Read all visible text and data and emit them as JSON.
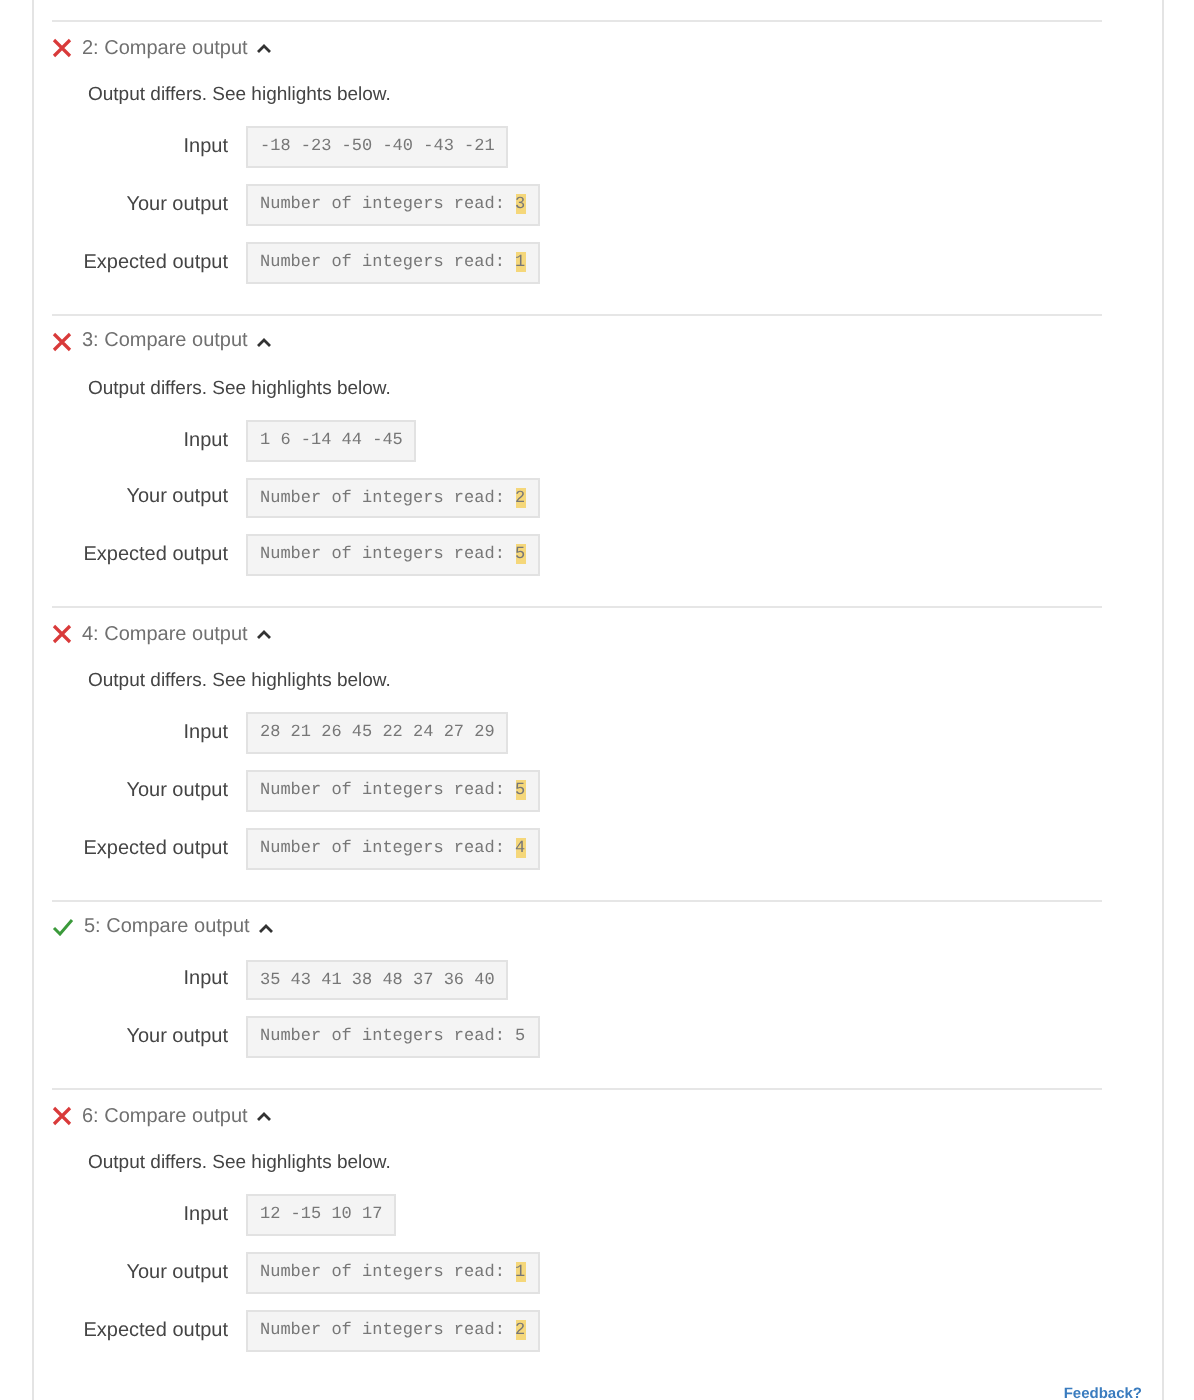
{
  "tests": [
    {
      "kind": "fail",
      "title": "2: Compare output",
      "expanded": true,
      "message": "Output differs. See highlights below.",
      "rows": [
        {
          "label": "Input",
          "text": "-18 -23 -50 -40 -43 -21"
        },
        {
          "label": "Your output",
          "text": "Number of integers read: ",
          "highlight": "3"
        },
        {
          "label": "Expected output",
          "text": "Number of integers read: ",
          "highlight": "1"
        }
      ]
    },
    {
      "kind": "fail",
      "title": "3: Compare output",
      "expanded": true,
      "message": "Output differs. See highlights below.",
      "rows": [
        {
          "label": "Input",
          "text": "1 6 -14 44 -45"
        },
        {
          "label": "Your output",
          "text": "Number of integers read: ",
          "highlight": "2"
        },
        {
          "label": "Expected output",
          "text": "Number of integers read: ",
          "highlight": "5"
        }
      ]
    },
    {
      "kind": "fail",
      "title": "4: Compare output",
      "expanded": true,
      "message": "Output differs. See highlights below.",
      "rows": [
        {
          "label": "Input",
          "text": "28 21 26 45 22 24 27 29"
        },
        {
          "label": "Your output",
          "text": "Number of integers read: ",
          "highlight": "5"
        },
        {
          "label": "Expected output",
          "text": "Number of integers read: ",
          "highlight": "4"
        }
      ]
    },
    {
      "kind": "pass",
      "title": "5: Compare output",
      "expanded": true,
      "rows": [
        {
          "label": "Input",
          "text": "35 43 41 38 48 37 36 40"
        },
        {
          "label": "Your output",
          "text": "Number of integers read: 5"
        }
      ]
    },
    {
      "kind": "fail",
      "title": "6: Compare output",
      "expanded": true,
      "message": "Output differs. See highlights below.",
      "rows": [
        {
          "label": "Input",
          "text": "12 -15 10 17"
        },
        {
          "label": "Your output",
          "text": "Number of integers read: ",
          "highlight": "1"
        },
        {
          "label": "Expected output",
          "text": "Number of integers read: ",
          "highlight": "2"
        }
      ]
    }
  ],
  "feedback_link": "Feedback?"
}
